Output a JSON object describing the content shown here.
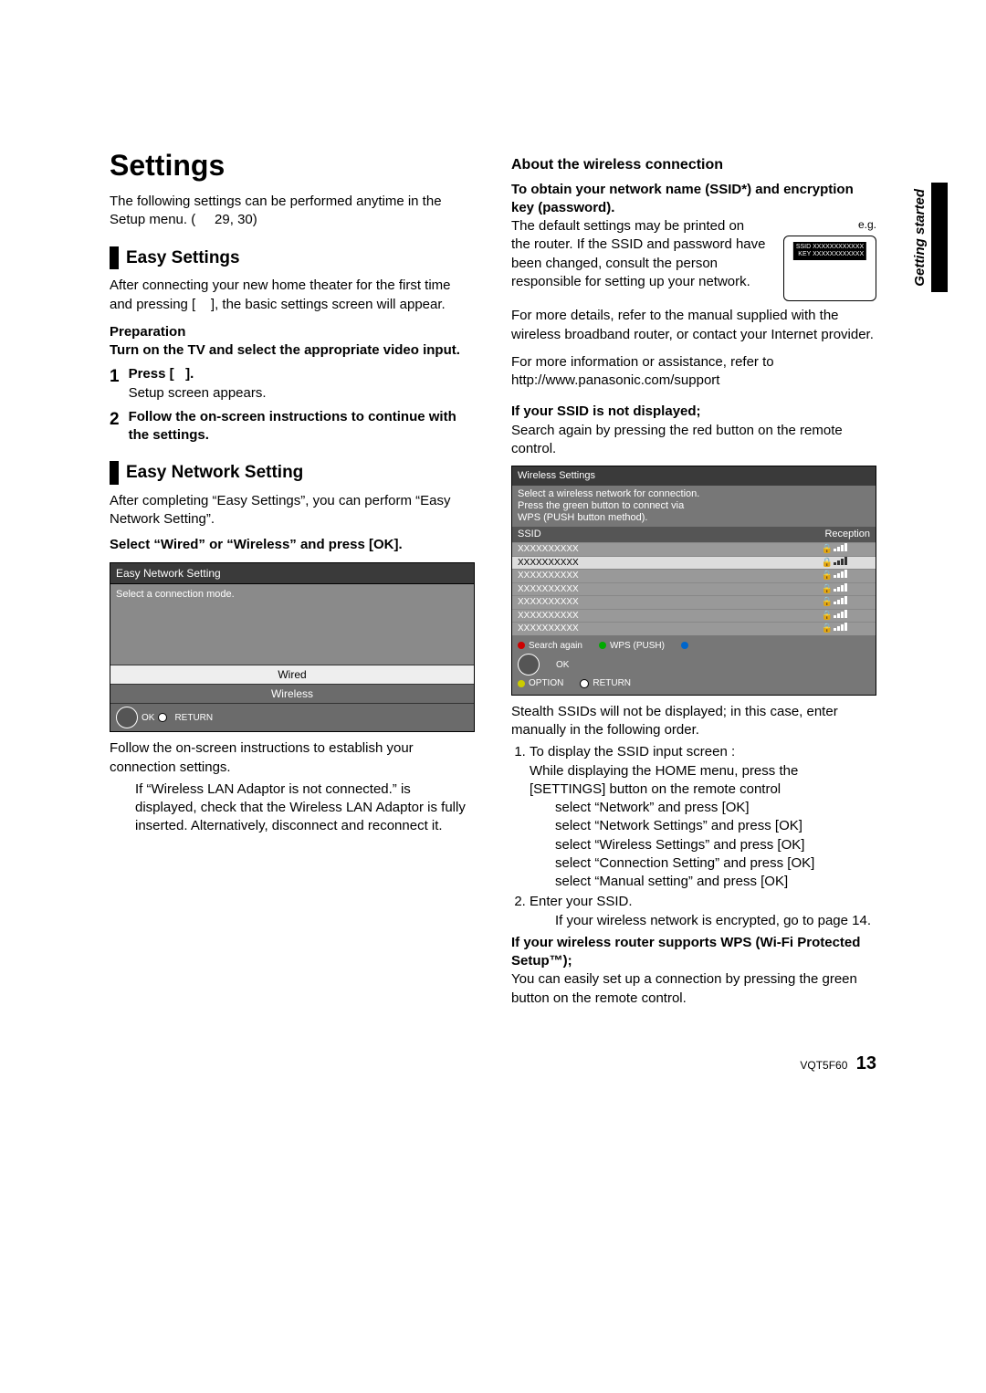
{
  "sideTab": "Getting started",
  "title": "Settings",
  "intro": "The following settings can be performed anytime in the Setup menu. (     29, 30)",
  "easySettings": {
    "heading": "Easy Settings",
    "para": "After connecting your new home theater for the first time and pressing [    ], the basic settings screen will appear.",
    "prepLabel": "Preparation",
    "prepText": "Turn on the TV and select the appropriate video input.",
    "steps": [
      {
        "num": "1",
        "bold": "Press [   ].",
        "text": "Setup screen appears."
      },
      {
        "num": "2",
        "bold": "Follow the on-screen instructions to continue with the settings.",
        "text": ""
      }
    ]
  },
  "easyNetwork": {
    "heading": "Easy Network Setting",
    "para": "After completing “Easy Settings”, you can perform “Easy Network Setting”.",
    "selectBold": "Select “Wired” or “Wireless” and press [OK].",
    "uiTitle": "Easy Network Setting",
    "uiBody": "Select a connection mode.",
    "uiWired": "Wired",
    "uiWireless": "Wireless",
    "navOK": "OK",
    "navReturn": "RETURN",
    "followText": "Follow the on-screen instructions to establish your connection settings.",
    "wlanNote": "If “Wireless LAN Adaptor is not connected.” is displayed, check that the Wireless LAN Adaptor is fully inserted. Alternatively, disconnect and reconnect it."
  },
  "wireless": {
    "heading": "About the wireless connection",
    "obtainBold": "To obtain your network name (SSID*) and encryption key (password).",
    "eg": "e.g.",
    "routerSSID": "SSID XXXXXXXXXXXX",
    "routerKey": "KEY XXXXXXXXXXXX",
    "defaultText": "The default settings may be printed on the router. If the SSID and password have been changed, consult the person responsible for setting up your network.",
    "moreDetails": "For more details, refer to the manual supplied with the wireless broadband router, or contact your Internet provider.",
    "moreInfo": "For more information or assistance, refer to http://www.panasonic.com/support",
    "ifSSIDBold": "If your SSID is not displayed;",
    "searchAgainText": "Search again by pressing the red button on the remote control.",
    "wsTitle": "Wireless Settings",
    "wsInstr1": "Select a wireless network for connection.",
    "wsInstr2": "Press the green button to connect via",
    "wsInstr3": "WPS (PUSH button method).",
    "wsHeadSSID": "SSID",
    "wsHeadRecep": "Reception",
    "wsRows": [
      "XXXXXXXXXX",
      "XXXXXXXXXX",
      "XXXXXXXXXX",
      "XXXXXXXXXX",
      "XXXXXXXXXX",
      "XXXXXXXXXX",
      "XXXXXXXXXX"
    ],
    "wsSearchAgain": "Search again",
    "wsWPS": "WPS (PUSH)",
    "wsOK": "OK",
    "wsOption": "OPTION",
    "wsReturn": "RETURN",
    "stealthText": "Stealth SSIDs will not be displayed; in this case, enter manually in the following order.",
    "step1a": "To display the SSID input screen :",
    "step1b": "While displaying the HOME menu, press the [SETTINGS] button on the remote control",
    "subSteps": [
      "select “Network” and press [OK]",
      "select “Network Settings” and press [OK]",
      "select “Wireless Settings” and press [OK]",
      "select “Connection Setting” and press [OK]",
      "select “Manual setting” and press [OK]"
    ],
    "step2a": "Enter your SSID.",
    "step2b": "If your wireless network is encrypted, go to page 14.",
    "wpsBold": "If your wireless router supports WPS (Wi-Fi Protected Setup™);",
    "wpsText": "You can easily set up a connection by pressing the green button on the remote control."
  },
  "footer": {
    "code": "VQT5F60",
    "page": "13"
  }
}
